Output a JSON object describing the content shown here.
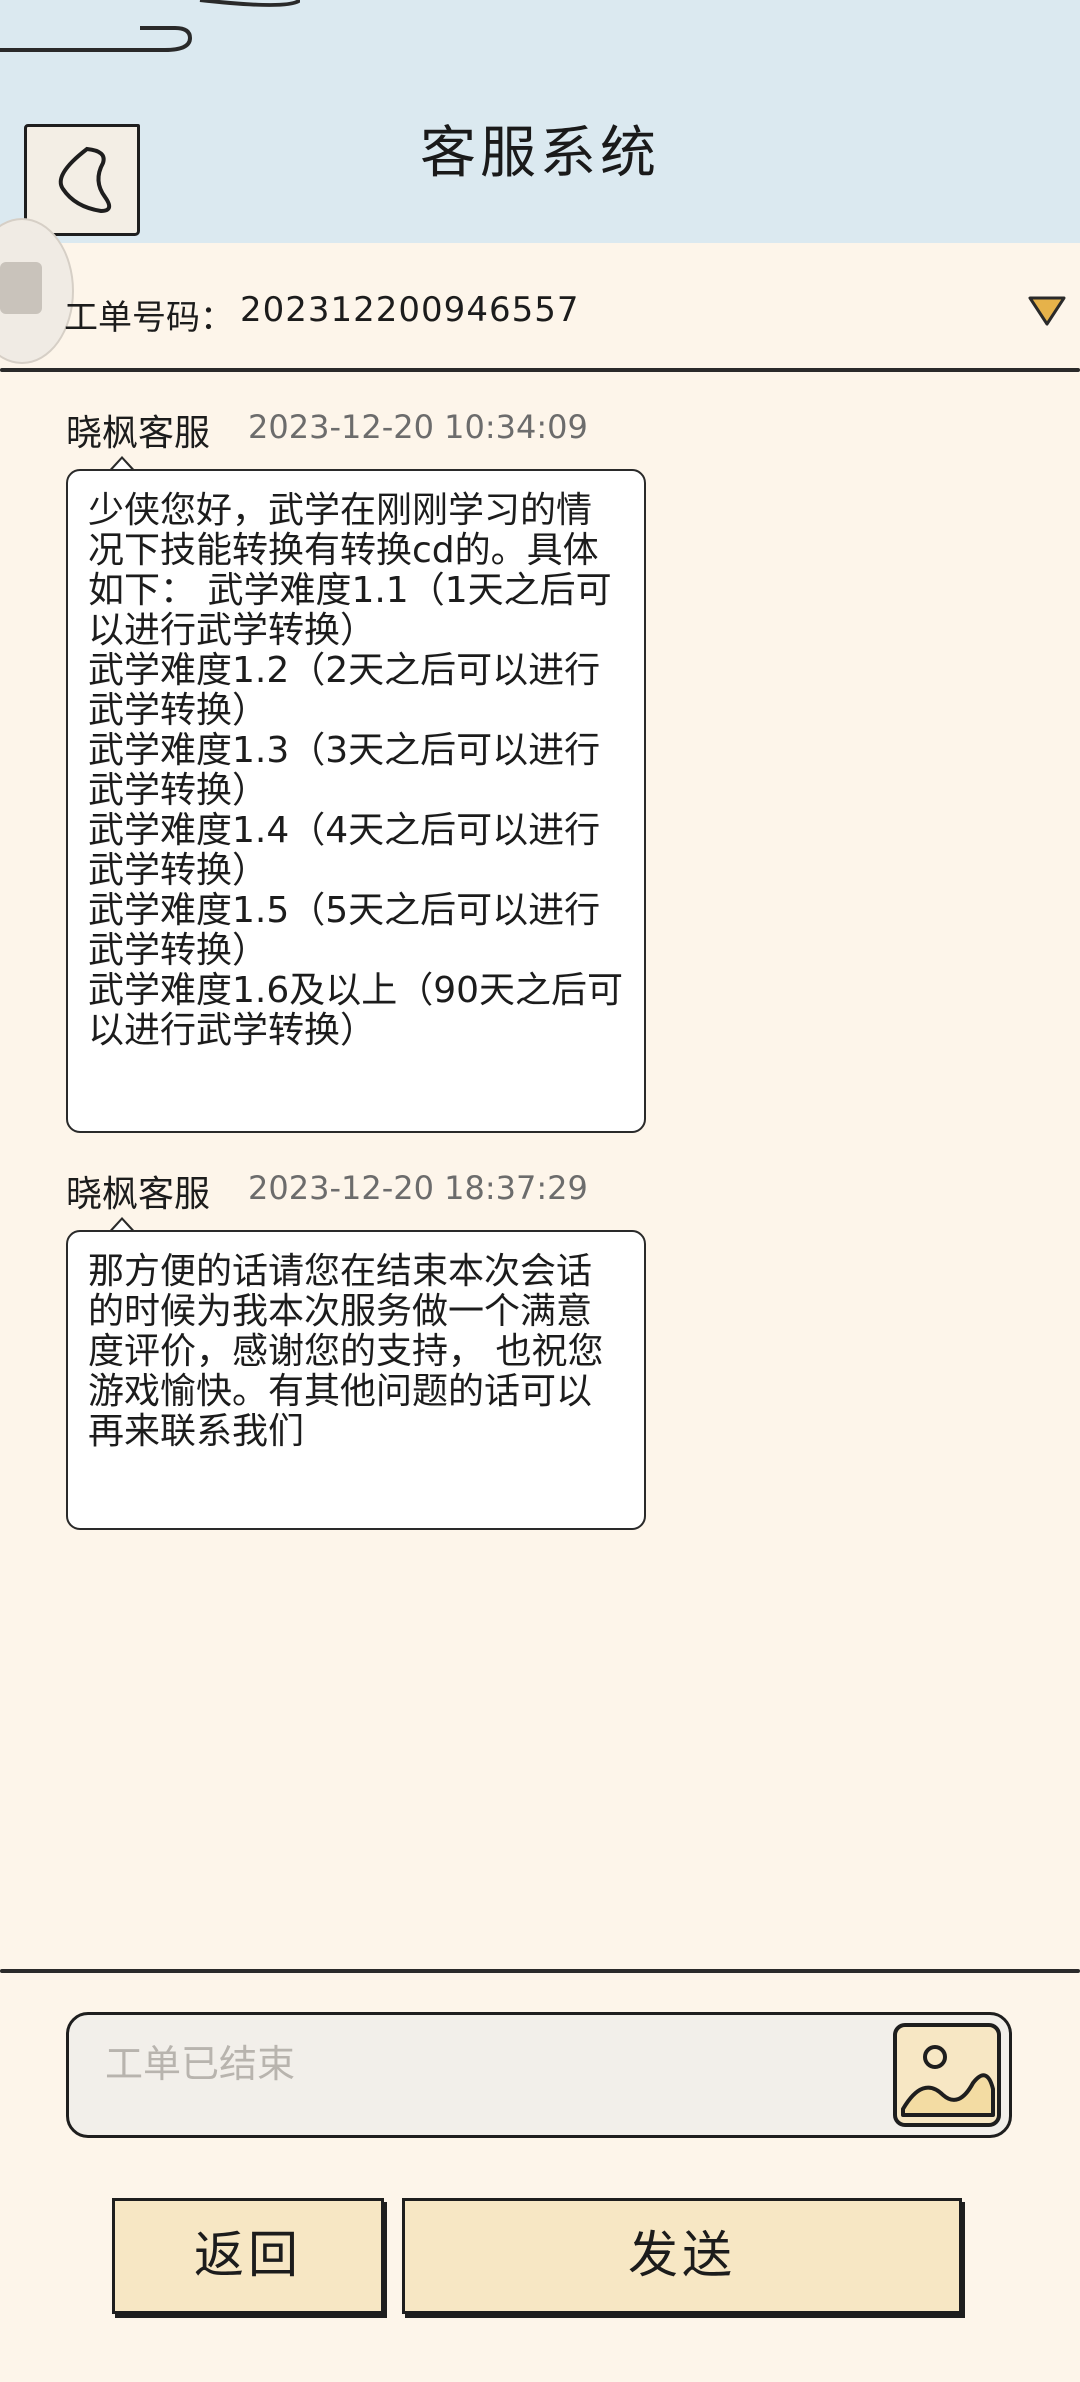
{
  "header": {
    "title": "客服系统",
    "back_icon": "chevron-left-icon"
  },
  "ticket": {
    "label": "工单号码：",
    "number": "202312200946557",
    "dropdown_icon": "triangle-down-icon"
  },
  "messages": [
    {
      "sender": "晓枫客服",
      "time": "2023-12-20 10:34:09",
      "text": "少侠您好，武学在刚刚学习的情况下技能转换有转换cd的。具体如下： 武学难度1.1（1天之后可以进行武学转换）\n武学难度1.2（2天之后可以进行武学转换）\n武学难度1.3（3天之后可以进行武学转换）\n武学难度1.4（4天之后可以进行武学转换）\n武学难度1.5（5天之后可以进行武学转换）\n武学难度1.6及以上（90天之后可以进行武学转换）"
    },
    {
      "sender": "晓枫客服",
      "time": "2023-12-20 18:37:29",
      "text": "那方便的话请您在结束本次会话的时候为我本次服务做一个满意度评价，感谢您的支持， 也祝您游戏愉快。有其他问题的话可以再来联系我们"
    }
  ],
  "composer": {
    "placeholder": "工单已结束",
    "image_icon": "image-icon"
  },
  "actions": {
    "back_label": "返回",
    "send_label": "发送"
  },
  "colors": {
    "header_bg": "#dbe9f0",
    "page_bg": "#fdf5ea",
    "button_bg": "#f7e7c4",
    "dropdown_accent": "#e6b24a"
  }
}
